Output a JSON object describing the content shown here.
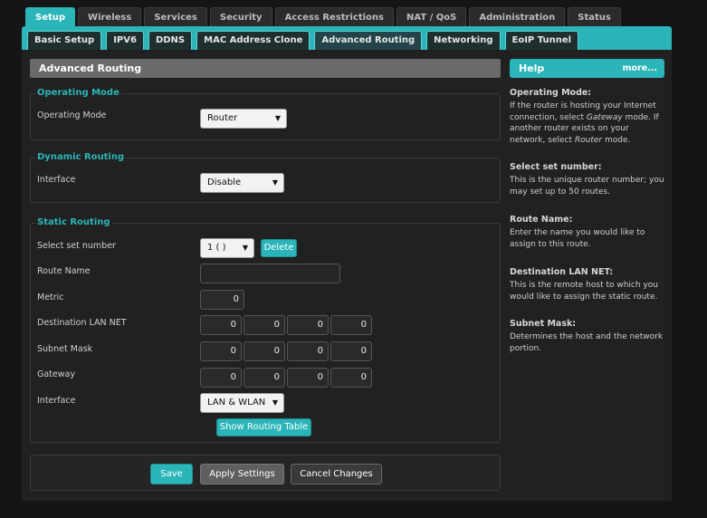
{
  "main_tabs": [
    "Setup",
    "Wireless",
    "Services",
    "Security",
    "Access Restrictions",
    "NAT / QoS",
    "Administration",
    "Status"
  ],
  "sub_tabs": [
    "Basic Setup",
    "IPV6",
    "DDNS",
    "MAC Address Clone",
    "Advanced Routing",
    "Networking",
    "EoIP Tunnel"
  ],
  "page": {
    "title": "Advanced Routing"
  },
  "operating_mode": {
    "legend": "Operating Mode",
    "label": "Operating Mode",
    "value": "Router"
  },
  "dynamic_routing": {
    "legend": "Dynamic Routing",
    "label": "Interface",
    "value": "Disable"
  },
  "static_routing": {
    "legend": "Static Routing",
    "select_set_label": "Select set number",
    "select_set_value": "1 ( )",
    "delete_label": "Delete",
    "route_name_label": "Route Name",
    "route_name_value": "",
    "metric_label": "Metric",
    "metric_value": "0",
    "dest_label": "Destination LAN NET",
    "dest": [
      "0",
      "0",
      "0",
      "0"
    ],
    "mask_label": "Subnet Mask",
    "mask": [
      "0",
      "0",
      "0",
      "0"
    ],
    "gateway_label": "Gateway",
    "gateway": [
      "0",
      "0",
      "0",
      "0"
    ],
    "interface_label": "Interface",
    "interface_value": "LAN & WLAN",
    "show_table_label": "Show Routing Table"
  },
  "footer": {
    "save": "Save",
    "apply": "Apply Settings",
    "cancel": "Cancel Changes"
  },
  "help": {
    "title": "Help",
    "more": "more...",
    "items": [
      {
        "title": "Operating Mode:",
        "desc_a": "If the router is hosting your Internet connection, select ",
        "desc_em1": "Gateway",
        "desc_b": " mode. If another router exists on your network, select ",
        "desc_em2": "Router",
        "desc_c": " mode."
      },
      {
        "title": "Select set number:",
        "desc": "This is the unique router number; you may set up to 50 routes."
      },
      {
        "title": "Route Name:",
        "desc": "Enter the name you would like to assign to this route."
      },
      {
        "title": "Destination LAN NET:",
        "desc": "This is the remote host to which you would like to assign the static route."
      },
      {
        "title": "Subnet Mask:",
        "desc": "Determines the host and the network portion."
      }
    ]
  },
  "colors": {
    "accent": "#2bb5b8",
    "background": "#151515",
    "panel": "#212121"
  }
}
